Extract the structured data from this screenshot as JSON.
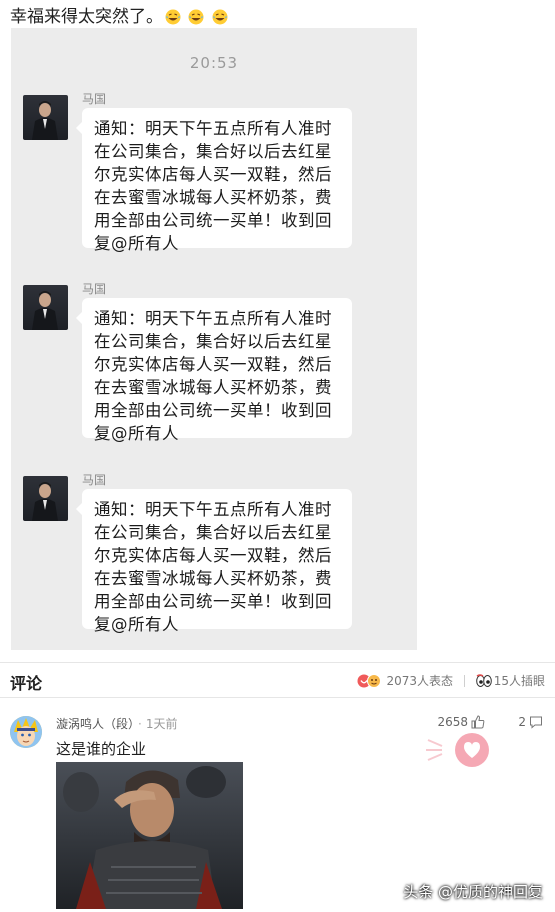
{
  "post": {
    "caption": "幸福来得太突然了。",
    "emoji": [
      "laughing-crying-emoji",
      "laughing-crying-emoji",
      "laughing-crying-emoji"
    ]
  },
  "chat": {
    "timestamp": "20:53",
    "messages": [
      {
        "sender": "马国",
        "text": "通知：明天下午五点所有人准时在公司集合，集合好以后去红星尔克实体店每人买一双鞋，然后在去蜜雪冰城每人买杯奶茶，费用全部由公司统一买单！收到回复@所有人"
      },
      {
        "sender": "马国",
        "text": "通知：明天下午五点所有人准时在公司集合，集合好以后去红星尔克实体店每人买一双鞋，然后在去蜜雪冰城每人买杯奶茶，费用全部由公司统一买单！收到回复@所有人"
      },
      {
        "sender": "马国",
        "text": "通知：明天下午五点所有人准时在公司集合，集合好以后去红星尔克实体店每人买一双鞋，然后在去蜜雪冰城每人买杯奶茶，费用全部由公司统一买单！收到回复@所有人"
      }
    ]
  },
  "comments": {
    "title": "评论",
    "reactions_label": "2073人表态",
    "eyes_label": "15人插眼",
    "items": [
      {
        "user": "漩涡鸣人（段）",
        "time": "1天前",
        "likes": "2658",
        "replies": "2",
        "text": "这是谁的企业"
      }
    ]
  },
  "watermark": "头条 @优质的神回复",
  "colors": {
    "chat_background": "#ececec",
    "bubble": "#ffffff",
    "reaction_red": "#f05a5a"
  }
}
